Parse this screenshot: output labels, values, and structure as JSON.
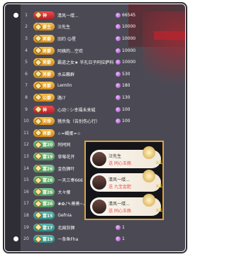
{
  "rows": [
    {
      "rank": "1",
      "badge": "神",
      "bcolor": "red",
      "name": "清风一缕...",
      "score": "66545"
    },
    {
      "rank": "2",
      "badge": "爵主",
      "bcolor": "gold",
      "name": "汪先生",
      "score": "10000"
    },
    {
      "rank": "3",
      "badge": "男爵",
      "bcolor": "gold",
      "name": "旧约 ☺星",
      "score": "10000"
    },
    {
      "rank": "4",
      "badge": "男爵",
      "bcolor": "gold",
      "name": "阿姨的…空欢",
      "score": "10000"
    },
    {
      "rank": "5",
      "badge": "男爵",
      "bcolor": "gold",
      "name": "霸道之女★ 半孔日子阿拉萨科",
      "score": "10000"
    },
    {
      "rank": "6",
      "badge": "男爵",
      "bcolor": "gold",
      "name": "水云籁群",
      "score": "530"
    },
    {
      "rank": "7",
      "badge": "男爵",
      "bcolor": "gold",
      "name": "Lem0n",
      "score": "180"
    },
    {
      "rank": "8",
      "badge": "公爵",
      "bcolor": "gold",
      "name": "路i7",
      "score": "130"
    },
    {
      "rank": "9",
      "badge": "神",
      "bcolor": "red",
      "name": "心动♡シ幸福未来城",
      "score": "100"
    },
    {
      "rank": "10",
      "badge": "天帝",
      "bcolor": "gold",
      "name": "猪杀兔（告别伤心行）",
      "score": "100"
    },
    {
      "rank": "11",
      "badge": "男爵",
      "bcolor": "gold",
      "name": "☆=蝎蛋=☆",
      "score": ""
    },
    {
      "rank": "12",
      "badge": "富20",
      "bcolor": "green",
      "name": "阿柯同",
      "score": ""
    },
    {
      "rank": "13",
      "badge": "富19",
      "bcolor": "green",
      "name": "草莓花开",
      "score": ""
    },
    {
      "rank": "14",
      "badge": "富26",
      "bcolor": "green",
      "name": "金色狮叶",
      "score": ""
    },
    {
      "rank": "15",
      "badge": "富26",
      "bcolor": "green",
      "name": "一天三枣666",
      "score": ""
    },
    {
      "rank": "16",
      "badge": "富26",
      "bcolor": "green",
      "name": "大々傻",
      "score": ""
    },
    {
      "rank": "17",
      "badge": "富26",
      "bcolor": "green",
      "name": "❀✿♪✎萧萧~♪☆",
      "score": ""
    },
    {
      "rank": "18",
      "badge": "富15",
      "bcolor": "teal",
      "name": "Gefnia",
      "score": "1"
    },
    {
      "rank": "19",
      "badge": "富17",
      "bcolor": "teal",
      "name": "北扁狂狮",
      "score": "1"
    },
    {
      "rank": "20",
      "badge": "富19",
      "bcolor": "teal",
      "name": "一条鱼Fha",
      "score": "1"
    }
  ],
  "gifts": [
    {
      "name": "汪先生",
      "line": "送 同心玉佩",
      "count": "x1"
    },
    {
      "name": "清风一缕...",
      "line": "送 九宝金肥",
      "count": "x1"
    },
    {
      "name": "清风一缕...",
      "line": "送 同心玉佩",
      "count": "x1"
    }
  ]
}
